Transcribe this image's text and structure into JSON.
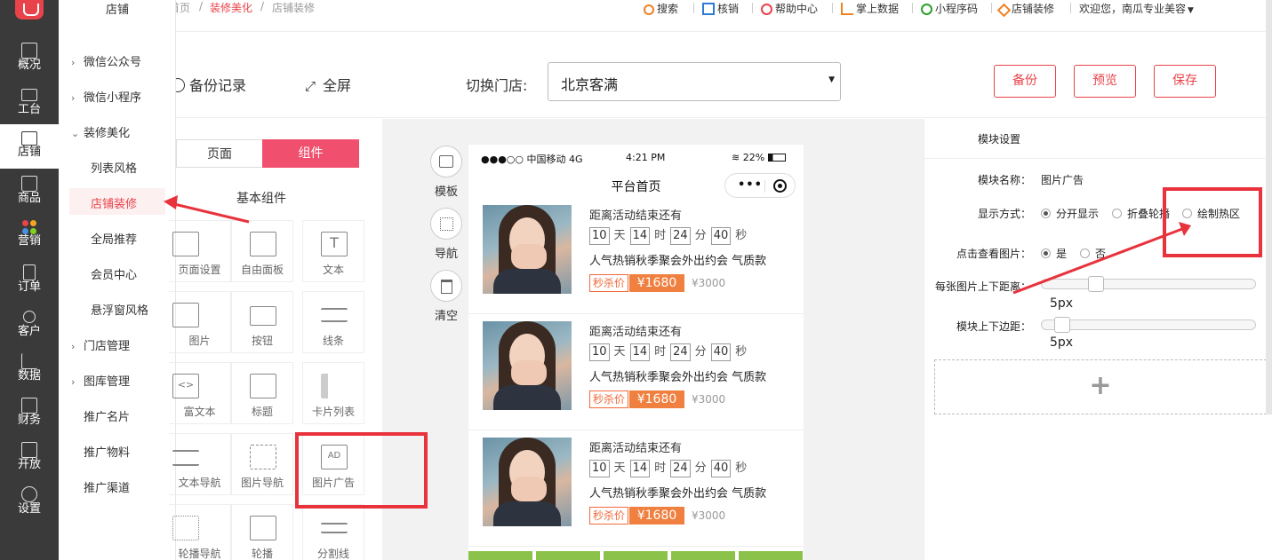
{
  "nav": {
    "items": [
      {
        "label": "概况",
        "icon": "chart-icon"
      },
      {
        "label": "工台",
        "icon": "monitor-icon"
      },
      {
        "label": "店铺",
        "icon": "store-icon"
      },
      {
        "label": "商品",
        "icon": "bag-icon"
      },
      {
        "label": "营销",
        "icon": "marketing-icon"
      },
      {
        "label": "订单",
        "icon": "order-icon"
      },
      {
        "label": "客户",
        "icon": "user-icon"
      },
      {
        "label": "数据",
        "icon": "data-icon"
      },
      {
        "label": "财务",
        "icon": "finance-icon"
      },
      {
        "label": "开放",
        "icon": "code-icon"
      },
      {
        "label": "设置",
        "icon": "gear-icon"
      }
    ],
    "active_index": 2
  },
  "subnav": {
    "title": "店铺",
    "groups": [
      "微信公众号",
      "微信小程序",
      "装修美化"
    ],
    "children": [
      "列表风格",
      "店铺装修",
      "全局推荐",
      "会员中心",
      "悬浮窗风格"
    ],
    "more_groups": [
      "门店管理",
      "图库管理"
    ],
    "plain": [
      "推广名片",
      "推广物料",
      "推广渠道"
    ]
  },
  "breadcrumb": [
    "首页",
    "装修美化",
    "店铺装修"
  ],
  "topbar": {
    "search": "搜索",
    "verify": "核销",
    "help": "帮助中心",
    "data": "掌上数据",
    "miniapp_code": "小程序码",
    "store_decor": "店铺装修",
    "welcome": "欢迎您，南瓜专业美容"
  },
  "toolbar": {
    "backup_record": "备份记录",
    "fullscreen": "全屏",
    "switch_store_label": "切换门店:",
    "store_value": "北京客满",
    "backup": "备份",
    "preview": "预览",
    "save": "保存"
  },
  "components": {
    "tab_page": "页面",
    "tab_component": "组件",
    "section": "基本组件",
    "items": [
      "页面设置",
      "自由面板",
      "文本",
      "图片",
      "按钮",
      "线条",
      "富文本",
      "标题",
      "卡片列表",
      "文本导航",
      "图片导航",
      "图片广告",
      "轮播导航",
      "轮播",
      "分割线"
    ]
  },
  "side_tools": [
    "模板",
    "导航",
    "清空"
  ],
  "phone": {
    "carrier": "●●●○○ 中国移动 4G",
    "time": "4:21 PM",
    "battery": "22%",
    "title": "平台首页",
    "cards": [
      {
        "head": "距离活动结束还有",
        "days": "10",
        "hours": "14",
        "minutes": "24",
        "seconds": "40",
        "name": "人气热销秋季聚会外出约会 气质款",
        "tag": "秒杀价",
        "price": "¥1680",
        "old_price": "¥3000"
      },
      {
        "head": "距离活动结束还有",
        "days": "10",
        "hours": "14",
        "minutes": "24",
        "seconds": "40",
        "name": "人气热销秋季聚会外出约会 气质款",
        "tag": "秒杀价",
        "price": "¥1680",
        "old_price": "¥3000"
      },
      {
        "head": "距离活动结束还有",
        "days": "10",
        "hours": "14",
        "minutes": "24",
        "seconds": "40",
        "name": "人气热销秋季聚会外出约会 气质款",
        "tag": "秒杀价",
        "price": "¥1680",
        "old_price": "¥3000"
      }
    ],
    "units": {
      "day": "天",
      "hour": "时",
      "minute": "分",
      "second": "秒"
    }
  },
  "settings": {
    "title": "模块设置",
    "module_name_label": "模块名称：",
    "module_name": "图片广告",
    "display_label": "显示方式：",
    "display_options": [
      "分开显示",
      "折叠轮播",
      "绘制热区"
    ],
    "click_label": "点击查看图片：",
    "click_options": [
      "是",
      "否"
    ],
    "spacing_label": "每张图片上下距离：",
    "spacing_value": "5px",
    "margin_label": "模块上下边距：",
    "margin_value": "5px"
  },
  "colors": {
    "accent": "#f0506e",
    "nav_bg": "#3a3a3a",
    "annotation": "#e8323c",
    "price": "#f08040"
  }
}
